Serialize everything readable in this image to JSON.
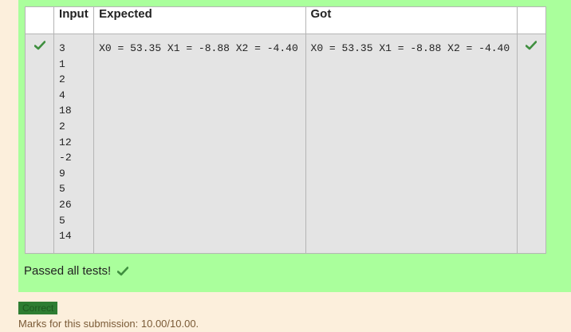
{
  "table": {
    "headers": {
      "check": "",
      "input": "Input",
      "expected": "Expected",
      "got": "Got",
      "check2": ""
    },
    "rows": [
      {
        "status": "pass",
        "input_lines": [
          "3",
          "1",
          "2",
          "4",
          "18",
          "2",
          "12",
          "-2",
          "9",
          "5",
          "26",
          "5",
          "14"
        ],
        "expected": "X0 = 53.35 X1 = -8.88 X2 = -4.40",
        "got": "X0 = 53.35 X1 = -8.88 X2 = -4.40"
      }
    ]
  },
  "summary": {
    "text": "Passed all tests!"
  },
  "grade_badge": {
    "label": "Correct"
  },
  "marks": {
    "text": "Marks for this submission: 10.00/10.00."
  },
  "colors": {
    "pass_green": "#3f8f3f",
    "feedback_bg": "#aaff9c",
    "page_bg": "#fcefdc"
  },
  "icons": {
    "row_status": "check-icon",
    "summary_status": "check-icon"
  }
}
